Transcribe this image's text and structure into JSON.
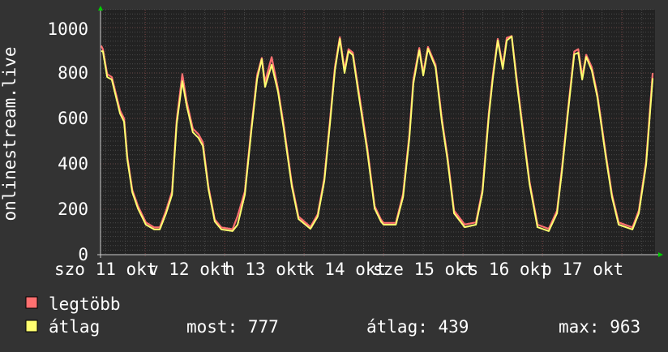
{
  "chart_data": {
    "type": "line",
    "ylabel": "onlinestream.live",
    "ylim": [
      0,
      1090
    ],
    "xlim_hours": [
      0,
      167.5
    ],
    "yticks": [
      "0",
      "200",
      "400",
      "600",
      "800",
      "1000"
    ],
    "ytick_values": [
      0,
      200,
      400,
      600,
      800,
      1000
    ],
    "xtick_labels": [
      "szo 11 okt",
      "v 12 okt",
      "h 13 okt",
      "k 14 okt",
      "sze 15 okt",
      "cs 16 okt",
      "p 17 okt"
    ],
    "midnight_hours": [
      13.5,
      37.5,
      61.5,
      85.5,
      109.5,
      133.5,
      157.5
    ],
    "grid": true,
    "x_hours": [
      0.2,
      0.7,
      2.0,
      3.4,
      5.9,
      7.1,
      8.1,
      9.6,
      11.3,
      13.7,
      16.2,
      17.9,
      19.8,
      21.6,
      23.0,
      24.7,
      26.0,
      27.9,
      29.6,
      30.9,
      32.6,
      34.5,
      36.5,
      39.9,
      41.4,
      43.6,
      45.6,
      47.3,
      48.7,
      49.7,
      51.7,
      53.6,
      55.4,
      57.8,
      59.8,
      63.4,
      65.6,
      67.6,
      69.3,
      70.8,
      72.3,
      73.7,
      74.9,
      76.2,
      78.1,
      80.6,
      82.8,
      84.7,
      85.5,
      89.2,
      91.4,
      93.3,
      94.5,
      96.3,
      97.5,
      98.9,
      101.2,
      103.1,
      104.8,
      106.8,
      110.0,
      113.4,
      115.4,
      117.3,
      118.5,
      120.0,
      121.5,
      122.7,
      124.2,
      125.6,
      127.6,
      129.6,
      132.0,
      135.4,
      137.9,
      139.4,
      141.1,
      143.1,
      144.3,
      145.5,
      146.7,
      148.4,
      150.1,
      152.6,
      154.5,
      156.5,
      160.7,
      162.6,
      164.8,
      166.8
    ],
    "series": [
      {
        "name": "legtöbb",
        "color": "#ff7070",
        "values": [
          920,
          905,
          795,
          782,
          635,
          600,
          430,
          285,
          215,
          142,
          120,
          120,
          195,
          278,
          590,
          795,
          675,
          555,
          530,
          495,
          300,
          155,
          120,
          112,
          170,
          278,
          565,
          790,
          866,
          760,
          870,
          730,
          565,
          312,
          168,
          122,
          178,
          338,
          590,
          825,
          958,
          815,
          905,
          890,
          710,
          470,
          214,
          155,
          140,
          140,
          268,
          530,
          770,
          910,
          800,
          915,
          835,
          600,
          432,
          194,
          133,
          142,
          288,
          625,
          790,
          950,
          830,
          955,
          963,
          790,
          552,
          322,
          132,
          114,
          194,
          385,
          625,
          895,
          905,
          785,
          880,
          825,
          705,
          445,
          265,
          142,
          120,
          194,
          410,
          800
        ]
      },
      {
        "name": "átlag",
        "color": "#ffff70",
        "values": [
          896,
          896,
          782,
          771,
          621,
          586,
          418,
          275,
          204,
          132,
          111,
          111,
          182,
          264,
          575,
          764,
          657,
          539,
          514,
          479,
          289,
          146,
          111,
          104,
          132,
          264,
          550,
          775,
          861,
          739,
          836,
          718,
          550,
          300,
          157,
          114,
          168,
          325,
          575,
          811,
          950,
          800,
          896,
          879,
          693,
          454,
          204,
          146,
          132,
          132,
          254,
          514,
          754,
          900,
          789,
          907,
          825,
          586,
          418,
          182,
          121,
          132,
          275,
          611,
          775,
          943,
          818,
          943,
          961,
          775,
          539,
          311,
          121,
          104,
          182,
          371,
          611,
          882,
          889,
          771,
          871,
          811,
          693,
          432,
          254,
          132,
          111,
          182,
          396,
          777
        ]
      }
    ]
  },
  "legend": {
    "items": [
      {
        "label": "legtöbb",
        "color": "#ff7070"
      },
      {
        "label": "átlag",
        "color": "#ffff70"
      }
    ],
    "stats": {
      "now": "most: 777",
      "avg": "átlag: 439",
      "max": "max: 963"
    }
  }
}
